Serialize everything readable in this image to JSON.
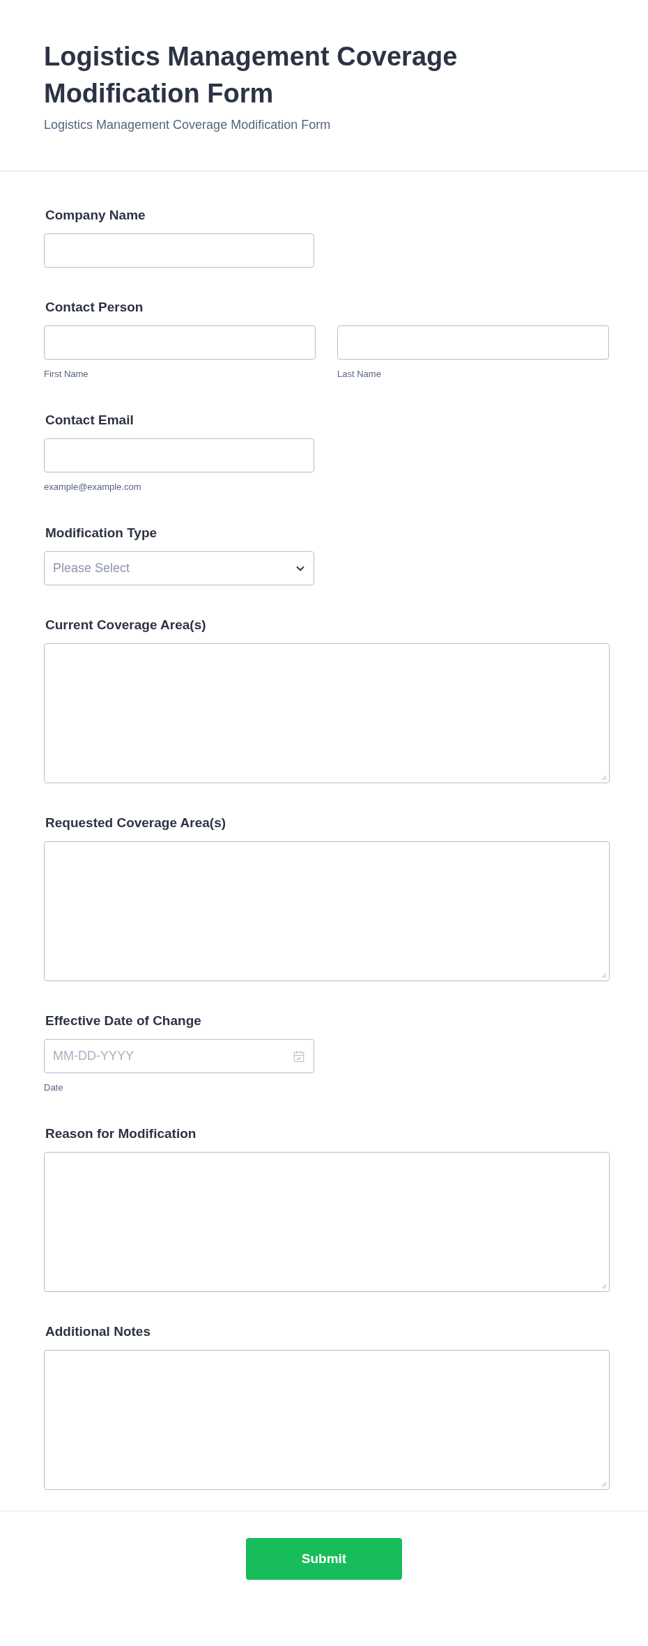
{
  "header": {
    "title": "Logistics Management Coverage Modification Form",
    "subtitle": "Logistics Management Coverage Modification Form"
  },
  "fields": [
    {
      "kind": "text",
      "label": "Company Name"
    },
    {
      "kind": "name",
      "label": "Contact Person",
      "sublabels": [
        "First Name",
        "Last Name"
      ]
    },
    {
      "kind": "email",
      "label": "Contact Email",
      "sublabel": "example@example.com"
    },
    {
      "kind": "select",
      "label": "Modification Type",
      "placeholder": "Please Select"
    },
    {
      "kind": "textarea",
      "label": "Current Coverage Area(s)"
    },
    {
      "kind": "textarea",
      "label": "Requested Coverage Area(s)"
    },
    {
      "kind": "date",
      "label": "Effective Date of Change",
      "placeholder": "MM-DD-YYYY",
      "sublabel": "Date"
    },
    {
      "kind": "textarea",
      "label": "Reason for Modification"
    },
    {
      "kind": "textarea",
      "label": "Additional Notes"
    }
  ],
  "submit": {
    "label": "Submit"
  }
}
